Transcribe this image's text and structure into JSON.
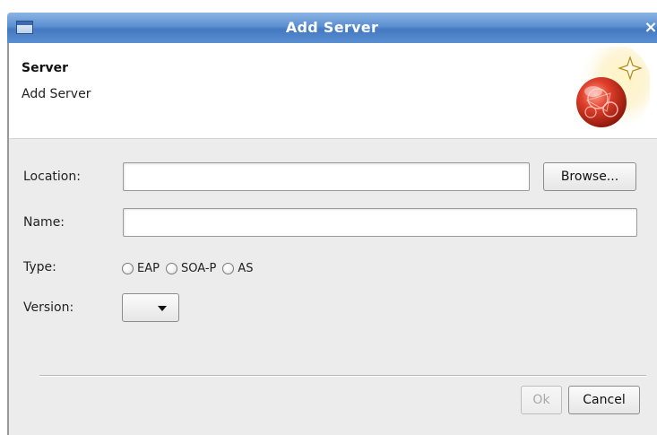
{
  "window": {
    "title": "Add Server",
    "close_glyph": "×"
  },
  "banner": {
    "title": "Server",
    "subtitle": "Add Server",
    "icon": "server-globe-sparkle-icon"
  },
  "form": {
    "location": {
      "label": "Location:",
      "value": "",
      "browse_label": "Browse..."
    },
    "name": {
      "label": "Name:",
      "value": ""
    },
    "type": {
      "label": "Type:",
      "options": [
        "EAP",
        "SOA-P",
        "AS"
      ],
      "selected": null
    },
    "version": {
      "label": "Version:",
      "selected": ""
    }
  },
  "footer": {
    "ok_label": "Ok",
    "ok_enabled": false,
    "cancel_label": "Cancel"
  }
}
